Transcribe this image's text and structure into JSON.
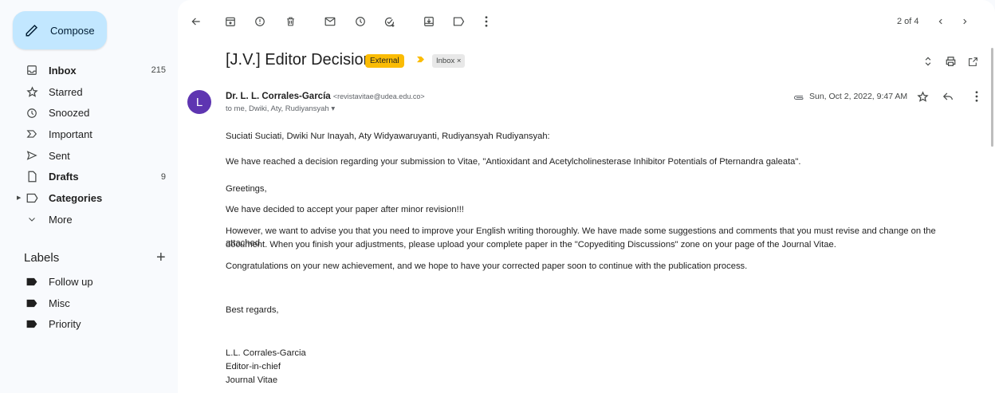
{
  "compose_label": "Compose",
  "nav": [
    {
      "label": "Inbox",
      "count": "215",
      "icon": "inbox-icon",
      "bold": true
    },
    {
      "label": "Starred",
      "count": "",
      "icon": "star-icon",
      "bold": false
    },
    {
      "label": "Snoozed",
      "count": "",
      "icon": "clock-icon",
      "bold": false
    },
    {
      "label": "Important",
      "count": "",
      "icon": "important-icon",
      "bold": false
    },
    {
      "label": "Sent",
      "count": "",
      "icon": "send-icon",
      "bold": false
    },
    {
      "label": "Drafts",
      "count": "9",
      "icon": "draft-icon",
      "bold": true
    },
    {
      "label": "Categories",
      "count": "",
      "icon": "label-icon",
      "bold": true
    },
    {
      "label": "More",
      "count": "",
      "icon": "chevron-down-icon",
      "bold": false
    }
  ],
  "labels_heading": "Labels",
  "labels": [
    "Follow up",
    "Misc",
    "Priority"
  ],
  "pager": "2 of 4",
  "subject": "[J.V.] Editor Decision",
  "chip_external": "External",
  "chip_inbox": "Inbox ×",
  "avatar_letter": "L",
  "sender_name": "Dr. L. L. Corrales-García",
  "sender_email": "<revistavitae@udea.edu.co>",
  "recipients": "to me, Dwiki, Aty, Rudiyansyah ▾",
  "date": "Sun, Oct 2, 2022, 9:47 AM",
  "body": {
    "salutation": "Suciati Suciati, Dwiki Nur Inayah, Aty Widyawaruyanti, Rudiyansyah Rudiyansyah:",
    "p1": "We have reached a decision regarding your submission to Vitae, \"Antioxidant and Acetylcholinesterase Inhibitor Potentials of Pternandra galeata\".",
    "p2": "Greetings,",
    "p3": "We have decided to accept your paper after minor revision!!!",
    "p4a": "However, we want to advise you that you need to improve your English writing thoroughly. We have made some suggestions and comments that you must revise and change on the attached",
    "p4b": "document. When you finish your adjustments, please upload your complete paper in the \"Copyediting Discussions\" zone on your page of the Journal Vitae.",
    "p5": "Congratulations on your new achievement, and we hope to have your corrected paper soon to continue with the publication process.",
    "closing": "Best regards,",
    "sig1": "L.L. Corrales-Garcia",
    "sig2": "Editor-in-chief",
    "sig3": "Journal Vitae"
  },
  "colors": {
    "compose_bg": "#c2e7ff",
    "external_chip": "#fbbc04",
    "avatar": "#5e35b1"
  }
}
